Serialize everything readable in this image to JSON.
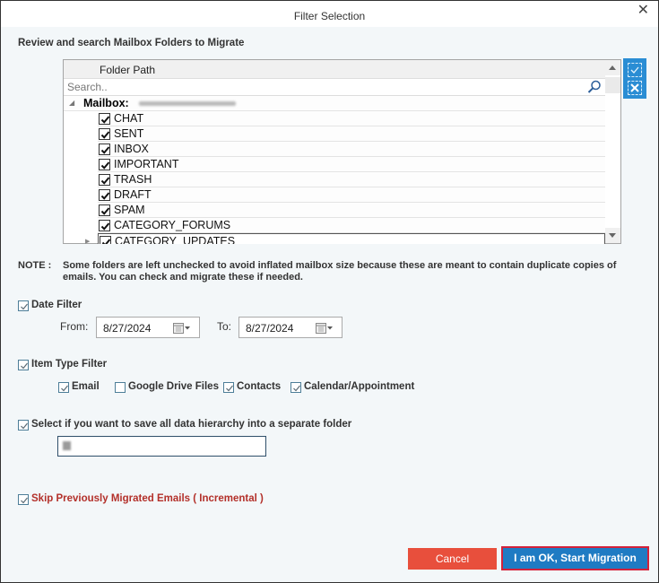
{
  "window": {
    "title": "Filter Selection",
    "close_icon": "close-x-icon"
  },
  "folders": {
    "heading": "Review and search Mailbox Folders to Migrate",
    "column_header": "Folder Path",
    "search_placeholder": "Search..",
    "search_value": "",
    "root": {
      "label": "Mailbox:",
      "email": "[redacted email]",
      "expanded": true
    },
    "items": [
      {
        "label": "CHAT",
        "checked": true
      },
      {
        "label": "SENT",
        "checked": true
      },
      {
        "label": "INBOX",
        "checked": true
      },
      {
        "label": "IMPORTANT",
        "checked": true
      },
      {
        "label": "TRASH",
        "checked": true
      },
      {
        "label": "DRAFT",
        "checked": true
      },
      {
        "label": "SPAM",
        "checked": true
      },
      {
        "label": "CATEGORY_FORUMS",
        "checked": true
      },
      {
        "label": "CATEGORY_UPDATES",
        "checked": true,
        "selected": true,
        "has_children": true
      }
    ],
    "side_tools": [
      {
        "name": "select-all",
        "icon": "dashed-check-icon"
      },
      {
        "name": "deselect-all",
        "icon": "dashed-x-icon"
      }
    ]
  },
  "note": {
    "label": "NOTE :",
    "text": "Some folders are left unchecked to avoid inflated mailbox size because these are meant to contain duplicate copies of emails. You can check and migrate these if needed."
  },
  "date_filter": {
    "label": "Date Filter",
    "checked": true,
    "from_label": "From:",
    "from_value": "8/27/2024",
    "to_label": "To:",
    "to_value": "8/27/2024"
  },
  "item_type_filter": {
    "label": "Item Type Filter",
    "checked": true,
    "types": [
      {
        "label": "Email",
        "checked": true
      },
      {
        "label": "Google Drive Files",
        "checked": false
      },
      {
        "label": "Contacts",
        "checked": true
      },
      {
        "label": "Calendar/Appointment",
        "checked": true
      }
    ]
  },
  "hierarchy": {
    "label": "Select if you want to save all data hierarchy into a separate folder",
    "checked": true,
    "folder_value": "[redacted]"
  },
  "incremental": {
    "label": "Skip Previously Migrated Emails ( Incremental )",
    "checked": true,
    "color": "#b3302a"
  },
  "buttons": {
    "cancel": "Cancel",
    "start": "I am OK, Start Migration"
  },
  "colors": {
    "accent_blue": "#1f7bc3",
    "cancel_red": "#e84f3c",
    "highlight_border": "#d3213a"
  }
}
